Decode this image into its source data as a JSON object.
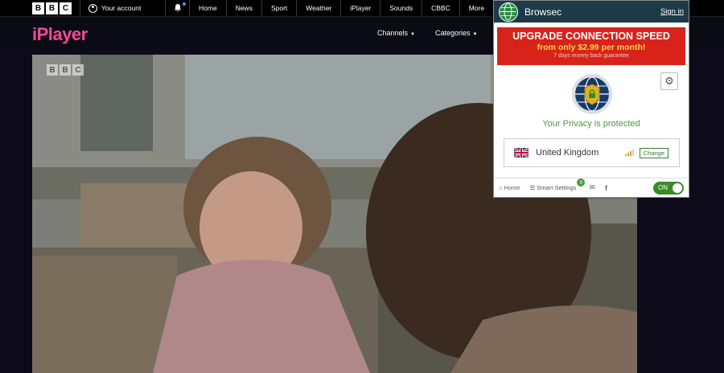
{
  "bbc_bar": {
    "logo_letters": [
      "B",
      "B",
      "C"
    ],
    "account_label": "Your account",
    "nav": [
      "Home",
      "News",
      "Sport",
      "Weather",
      "iPlayer",
      "Sounds",
      "CBBC",
      "More"
    ]
  },
  "iplayer": {
    "logo": "iPlayer",
    "channels": "Channels",
    "categories": "Categories"
  },
  "video": {
    "watermark_letters": [
      "B",
      "B",
      "C"
    ]
  },
  "browsec": {
    "brand": "Browsec",
    "signin": "Sign in",
    "promo_title": "UPGRADE CONNECTION SPEED",
    "promo_sub": "from only $2.99 per month!",
    "promo_note": "7 days money back guarantee",
    "privacy_text": "Your Privacy is protected",
    "country": "United Kingdom",
    "change_label": "Change",
    "footer": {
      "home": "Home",
      "smart_settings": "Smart Settings",
      "smart_badge": "0",
      "toggle": "ON"
    }
  },
  "colors": {
    "iplayer_pink": "#f54997",
    "browsec_header": "#1d3a48",
    "promo_red": "#d8231a",
    "protected_green": "#4a9a3c"
  }
}
